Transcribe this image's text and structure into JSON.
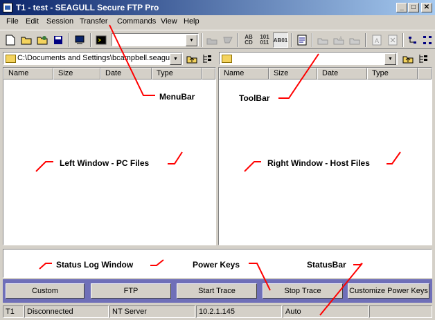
{
  "window": {
    "title": "T1 - test - SEAGULL Secure FTP Pro",
    "minimize": "_",
    "maximize": "□",
    "close": "✕"
  },
  "menu": [
    "File",
    "Edit",
    "Session",
    "Transfer",
    "Commands",
    "View",
    "Help"
  ],
  "toolbar": {
    "session_combo_value": "",
    "ascii_label": "A B C D",
    "binary_label": "101 011",
    "auto_label": "AB01"
  },
  "left_pane": {
    "path": "C:\\Documents and Settings\\bcampbell.seagull",
    "columns": [
      "Name",
      "Size",
      "Date",
      "Type"
    ]
  },
  "right_pane": {
    "path": "",
    "columns": [
      "Name",
      "Size",
      "Date",
      "Type"
    ]
  },
  "annotations": {
    "menubar": "MenuBar",
    "toolbar": "ToolBar",
    "left_window": "Left Window - PC Files",
    "right_window": "Right Window - Host Files",
    "status_log": "Status Log Window",
    "power_keys": "Power Keys",
    "statusbar": "StatusBar"
  },
  "power_keys": [
    "Custom",
    "FTP",
    "Start Trace",
    "Stop Trace",
    "Customize Power Keys"
  ],
  "statusbar": [
    "T1",
    "Disconnected",
    "NT Server",
    "10.2.1.145",
    "Auto",
    ""
  ],
  "colors": {
    "title_start": "#0a246a",
    "title_end": "#a6caf0",
    "power_key_bar": "#6f6fb8",
    "annotation_line": "#ff0000"
  }
}
